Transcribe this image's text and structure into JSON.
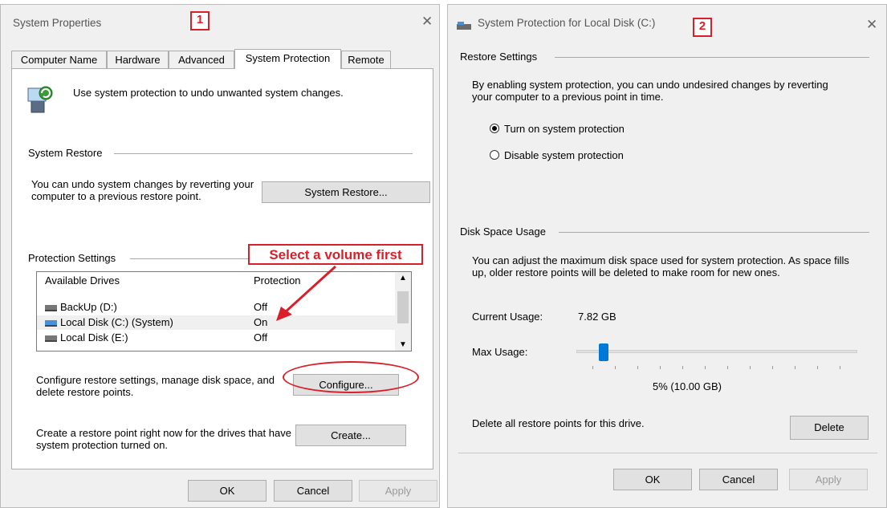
{
  "left": {
    "title": "System Properties",
    "step": "1",
    "tabs": [
      "Computer Name",
      "Hardware",
      "Advanced",
      "System Protection",
      "Remote"
    ],
    "intro": "Use system protection to undo unwanted system changes.",
    "restore_group": "System Restore",
    "restore_text": "You can undo system changes by reverting your computer to a previous restore point.",
    "restore_button": "System Restore...",
    "protection_group": "Protection Settings",
    "callout": "Select a volume first",
    "columns": [
      "Available Drives",
      "Protection"
    ],
    "drives": [
      {
        "name": "BackUp (D:)",
        "status": "Off"
      },
      {
        "name": "Local Disk (C:) (System)",
        "status": "On"
      },
      {
        "name": "Local Disk (E:)",
        "status": "Off"
      }
    ],
    "configure_text": "Configure restore settings, manage disk space, and delete restore points.",
    "configure_button": "Configure...",
    "create_text": "Create a restore point right now for the drives that have system protection turned on.",
    "create_button": "Create...",
    "ok": "OK",
    "cancel": "Cancel",
    "apply": "Apply"
  },
  "right": {
    "title": "System Protection for Local Disk (C:)",
    "step": "2",
    "restore_group": "Restore Settings",
    "restore_text": "By enabling system protection, you can undo undesired changes by reverting your computer to a previous point in time.",
    "option_on": "Turn on system protection",
    "option_off": "Disable system protection",
    "selected_option": "Turn on system protection",
    "disk_group": "Disk Space Usage",
    "disk_text": "You can adjust the maximum disk space used for system protection. As space fills up, older restore points will be deleted to make room for new ones.",
    "current_label": "Current Usage:",
    "current_value": "7.82 GB",
    "max_label": "Max Usage:",
    "max_fraction": 0.05,
    "max_value": "5% (10.00 GB)",
    "delete_text": "Delete all restore points for this drive.",
    "delete_button": "Delete",
    "ok": "OK",
    "cancel": "Cancel",
    "apply": "Apply"
  },
  "colors": {
    "annotation": "#d9202a",
    "accent": "#0078d7"
  }
}
